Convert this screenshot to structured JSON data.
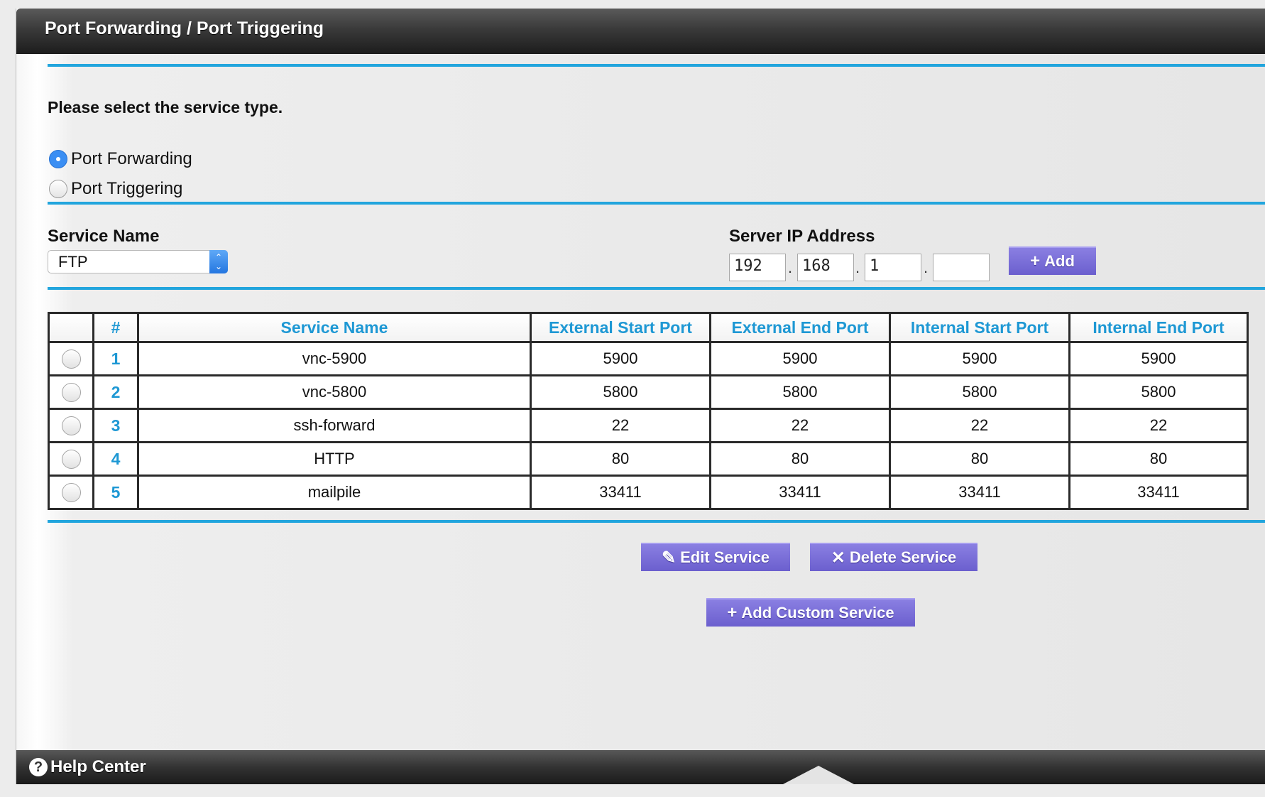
{
  "header": {
    "title": "Port Forwarding / Port Triggering"
  },
  "service_type": {
    "prompt": "Please select the service type.",
    "options": [
      {
        "label": "Port Forwarding",
        "selected": true
      },
      {
        "label": "Port Triggering",
        "selected": false
      }
    ]
  },
  "form": {
    "service_name_label": "Service Name",
    "service_name_value": "FTP",
    "server_ip_label": "Server IP Address",
    "ip_octets": [
      "192",
      "168",
      "1",
      ""
    ],
    "ip_separator": ".",
    "add_label": "Add"
  },
  "table": {
    "headers": [
      "",
      "#",
      "Service Name",
      "External Start Port",
      "External End Port",
      "Internal Start Port",
      "Internal End Port"
    ],
    "rows": [
      {
        "num": "1",
        "name": "vnc-5900",
        "ext_start": "5900",
        "ext_end": "5900",
        "int_start": "5900",
        "int_end": "5900"
      },
      {
        "num": "2",
        "name": "vnc-5800",
        "ext_start": "5800",
        "ext_end": "5800",
        "int_start": "5800",
        "int_end": "5800"
      },
      {
        "num": "3",
        "name": "ssh-forward",
        "ext_start": "22",
        "ext_end": "22",
        "int_start": "22",
        "int_end": "22"
      },
      {
        "num": "4",
        "name": "HTTP",
        "ext_start": "80",
        "ext_end": "80",
        "int_start": "80",
        "int_end": "80"
      },
      {
        "num": "5",
        "name": "mailpile",
        "ext_start": "33411",
        "ext_end": "33411",
        "int_start": "33411",
        "int_end": "33411"
      }
    ]
  },
  "actions": {
    "edit_label": "Edit Service",
    "delete_label": "Delete Service",
    "add_custom_label": "Add Custom Service"
  },
  "footer": {
    "help_label": "Help Center"
  },
  "colors": {
    "accent": "#22a5dd",
    "button": "#7a6fd8",
    "header_bar": "#333333"
  }
}
